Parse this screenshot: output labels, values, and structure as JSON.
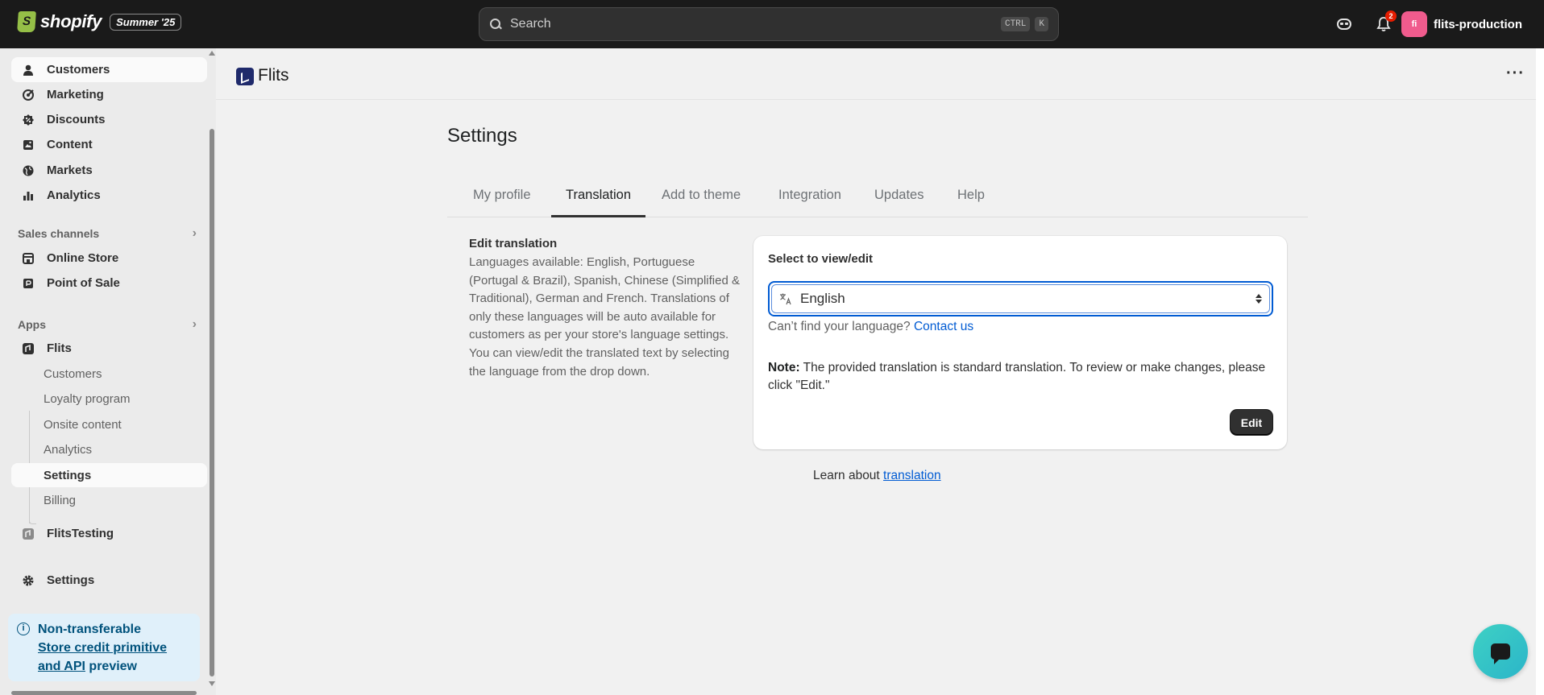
{
  "topbar": {
    "wordmark": "shopify",
    "edition": "Summer '25",
    "search_placeholder": "Search",
    "shortcut_key1": "CTRL",
    "shortcut_key2": "K",
    "notification_count": "2",
    "store_initials": "fi",
    "store_name": "flits-production"
  },
  "sidebar": {
    "nav": [
      {
        "label": "Customers"
      },
      {
        "label": "Marketing"
      },
      {
        "label": "Discounts"
      },
      {
        "label": "Content"
      },
      {
        "label": "Markets"
      },
      {
        "label": "Analytics"
      }
    ],
    "sales_channels_heading": "Sales channels",
    "sales_channels": [
      {
        "label": "Online Store"
      },
      {
        "label": "Point of Sale"
      }
    ],
    "apps_heading": "Apps",
    "app_flits": "Flits",
    "flits_sub": [
      {
        "label": "Customers"
      },
      {
        "label": "Loyalty program"
      },
      {
        "label": "Onsite content"
      },
      {
        "label": "Analytics"
      },
      {
        "label": "Settings"
      },
      {
        "label": "Billing"
      }
    ],
    "app_flitstesting": "FlitsTesting",
    "settings": "Settings",
    "info_card": {
      "title": "Non-transferable",
      "link_text": "Store credit primitive and API",
      "suffix": " preview"
    }
  },
  "app_header": {
    "title": "Flits"
  },
  "main": {
    "page_title": "Settings",
    "tabs": [
      {
        "label": "My profile"
      },
      {
        "label": "Translation"
      },
      {
        "label": "Add to theme"
      },
      {
        "label": "Integration"
      },
      {
        "label": "Updates"
      },
      {
        "label": "Help"
      }
    ],
    "active_tab": "Translation",
    "edit_translation": {
      "title": "Edit translation",
      "body": "Languages available: English, Portuguese (Portugal & Brazil), Spanish, Chinese (Simplified & Traditional), German and French. Translations of only these languages will be auto available for customers as per your store's language settings. You can view/edit the translated text by selecting the language from the drop down."
    },
    "card": {
      "label": "Select to view/edit",
      "selected_language": "English",
      "help_text": "Can’t find your language?",
      "help_link": "Contact us",
      "note_label": "Note:",
      "note_text": " The provided translation is standard translation. To review or make changes, please click \"Edit.\"",
      "edit_button": "Edit"
    },
    "learn": {
      "prefix": "Learn about ",
      "link": "translation"
    }
  }
}
